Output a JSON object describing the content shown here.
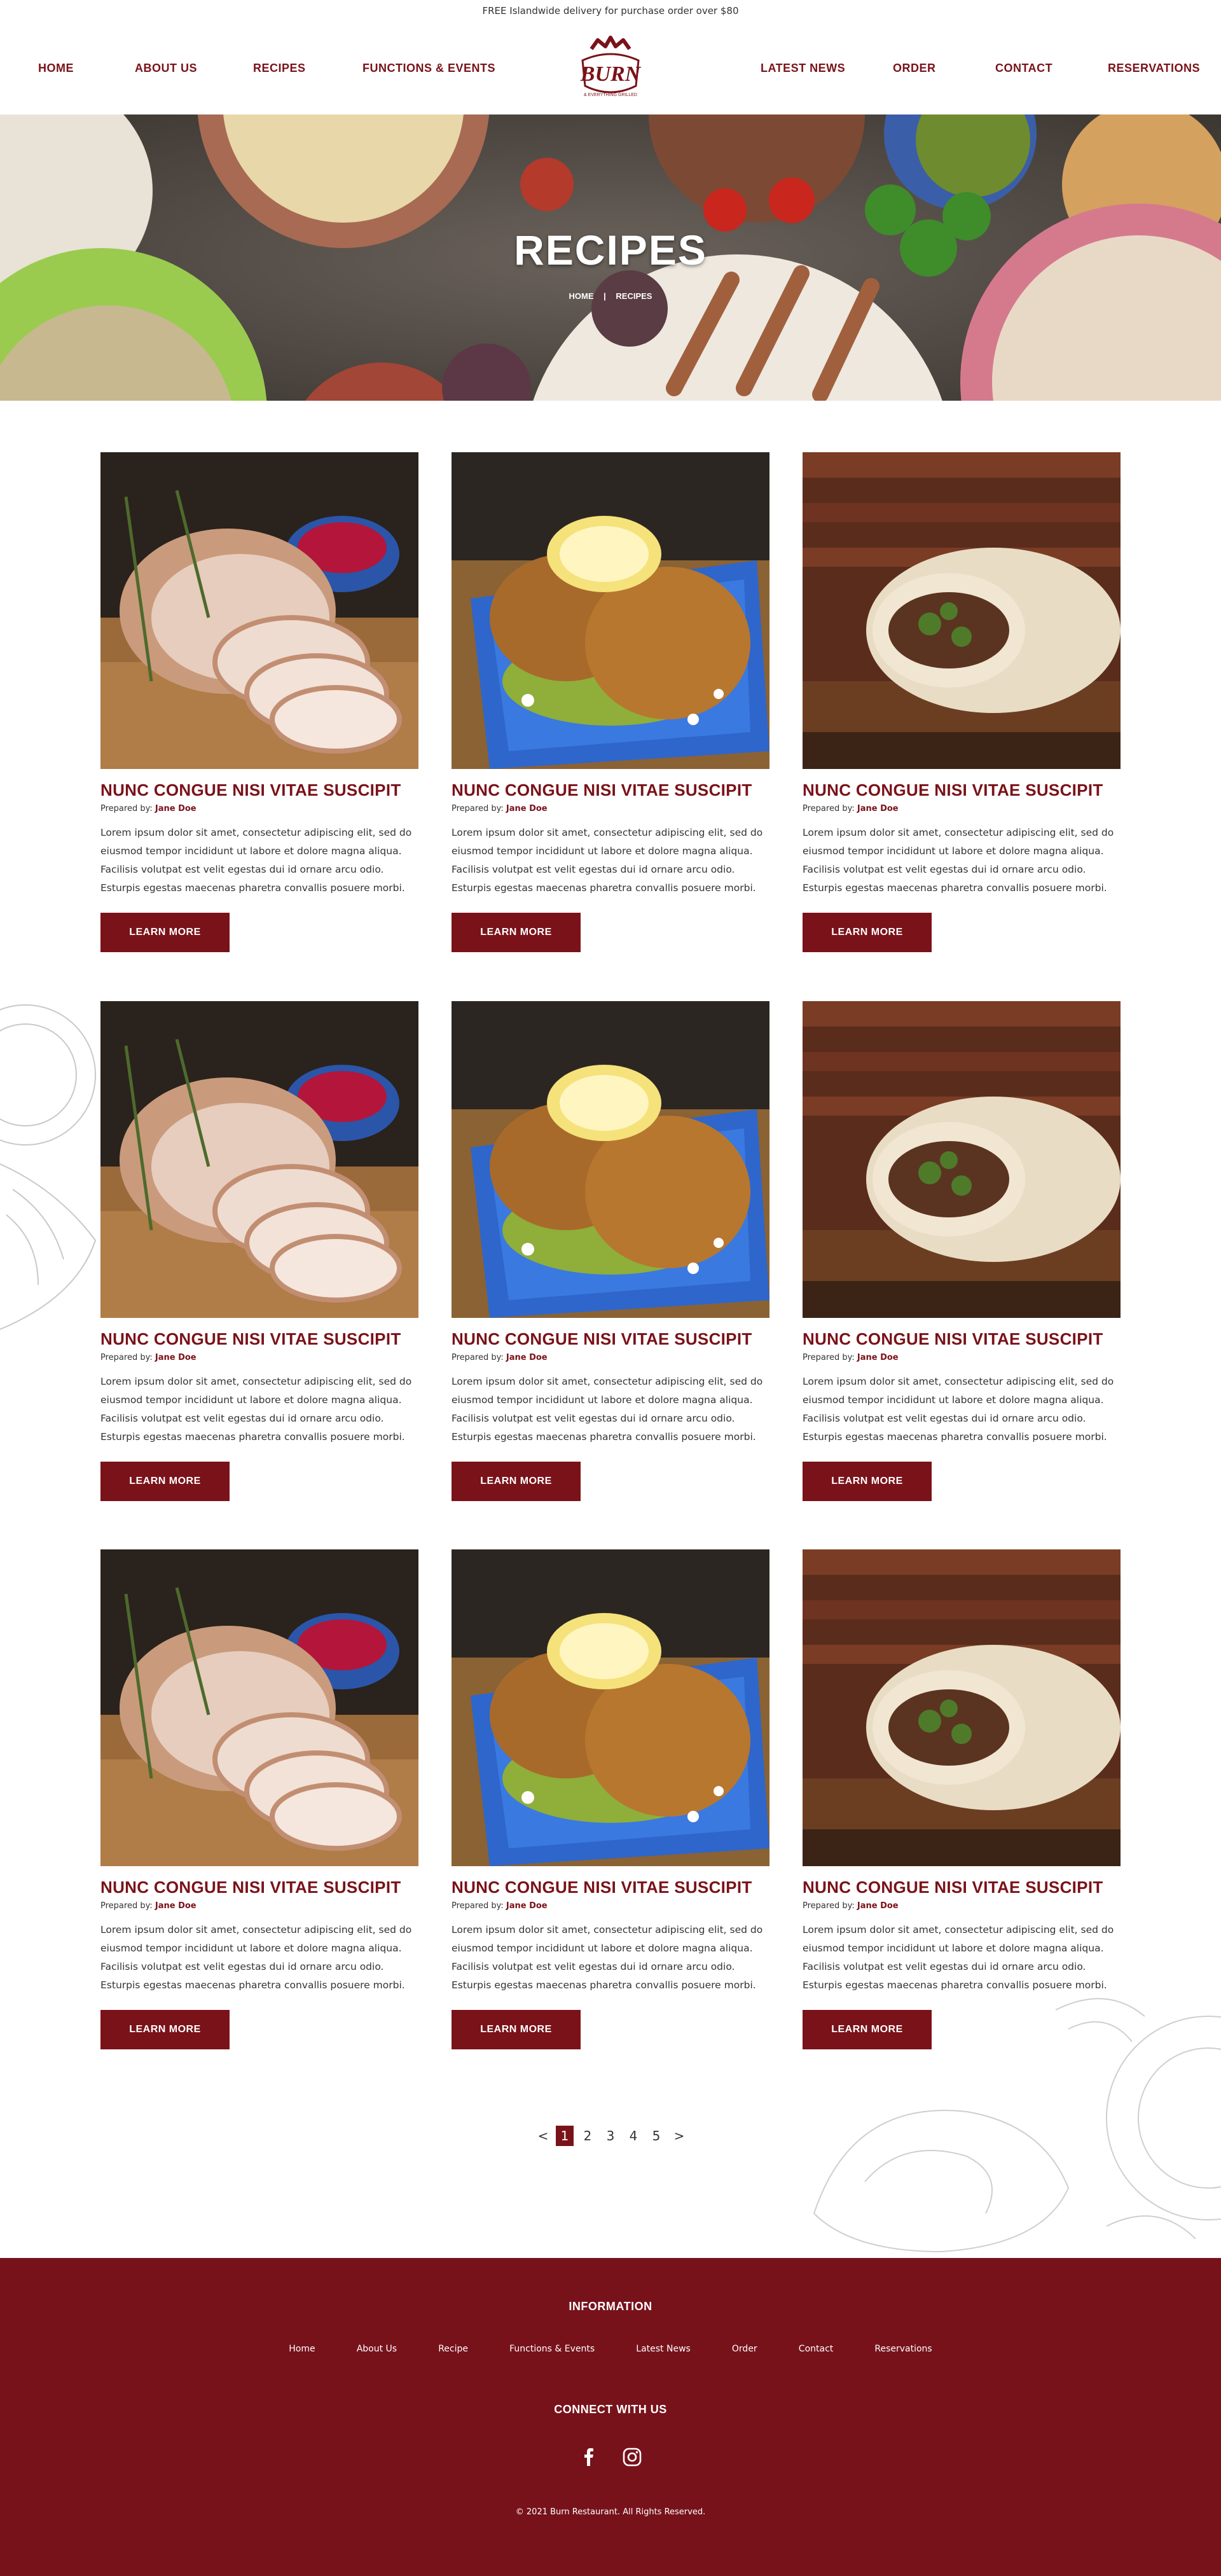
{
  "topbar": {
    "text": "FREE Islandwide delivery for purchase order over $80"
  },
  "nav": {
    "home": "HOME",
    "about": "ABOUT US",
    "recipes": "RECIPES",
    "functions": "FUNCTIONS & EVENTS",
    "news": "LATEST NEWS",
    "order": "ORDER",
    "contact": "CONTACT",
    "reservations": "RESERVATIONS"
  },
  "logo": {
    "word": "BURN",
    "tagline": "& EVERYTHING GRILLED"
  },
  "hero": {
    "title": "RECIPES",
    "crumb_home": "HOME",
    "crumb_sep": "|",
    "crumb_current": "RECIPES"
  },
  "recipe": {
    "title": "NUNC CONGUE NISI VITAE SUSCIPIT",
    "prepared_label": "Prepared by:",
    "author": "Jane Doe",
    "body": "Lorem ipsum dolor sit amet, consectetur adipiscing elit, sed do eiusmod tempor incididunt ut labore et dolore magna aliqua. Facilisis volutpat est velit egestas dui id ornare arcu odio. Esturpis egestas maecenas pharetra convallis posuere morbi.",
    "button": "LEARN MORE"
  },
  "pagination": {
    "prev": "<",
    "pages": [
      "1",
      "2",
      "3",
      "4",
      "5"
    ],
    "next": ">",
    "current": "1"
  },
  "footer": {
    "info_heading": "INFORMATION",
    "links": [
      "Home",
      "About Us",
      "Recipe",
      "Functions & Events",
      "Latest News",
      "Order",
      "Contact",
      "Reservations"
    ],
    "connect_heading": "CONNECT WITH US",
    "copyright": "© 2021 Burn Restaurant. All Rights Reserved."
  },
  "colors": {
    "brand": "#7a1219",
    "footer_bg": "#77121b"
  }
}
